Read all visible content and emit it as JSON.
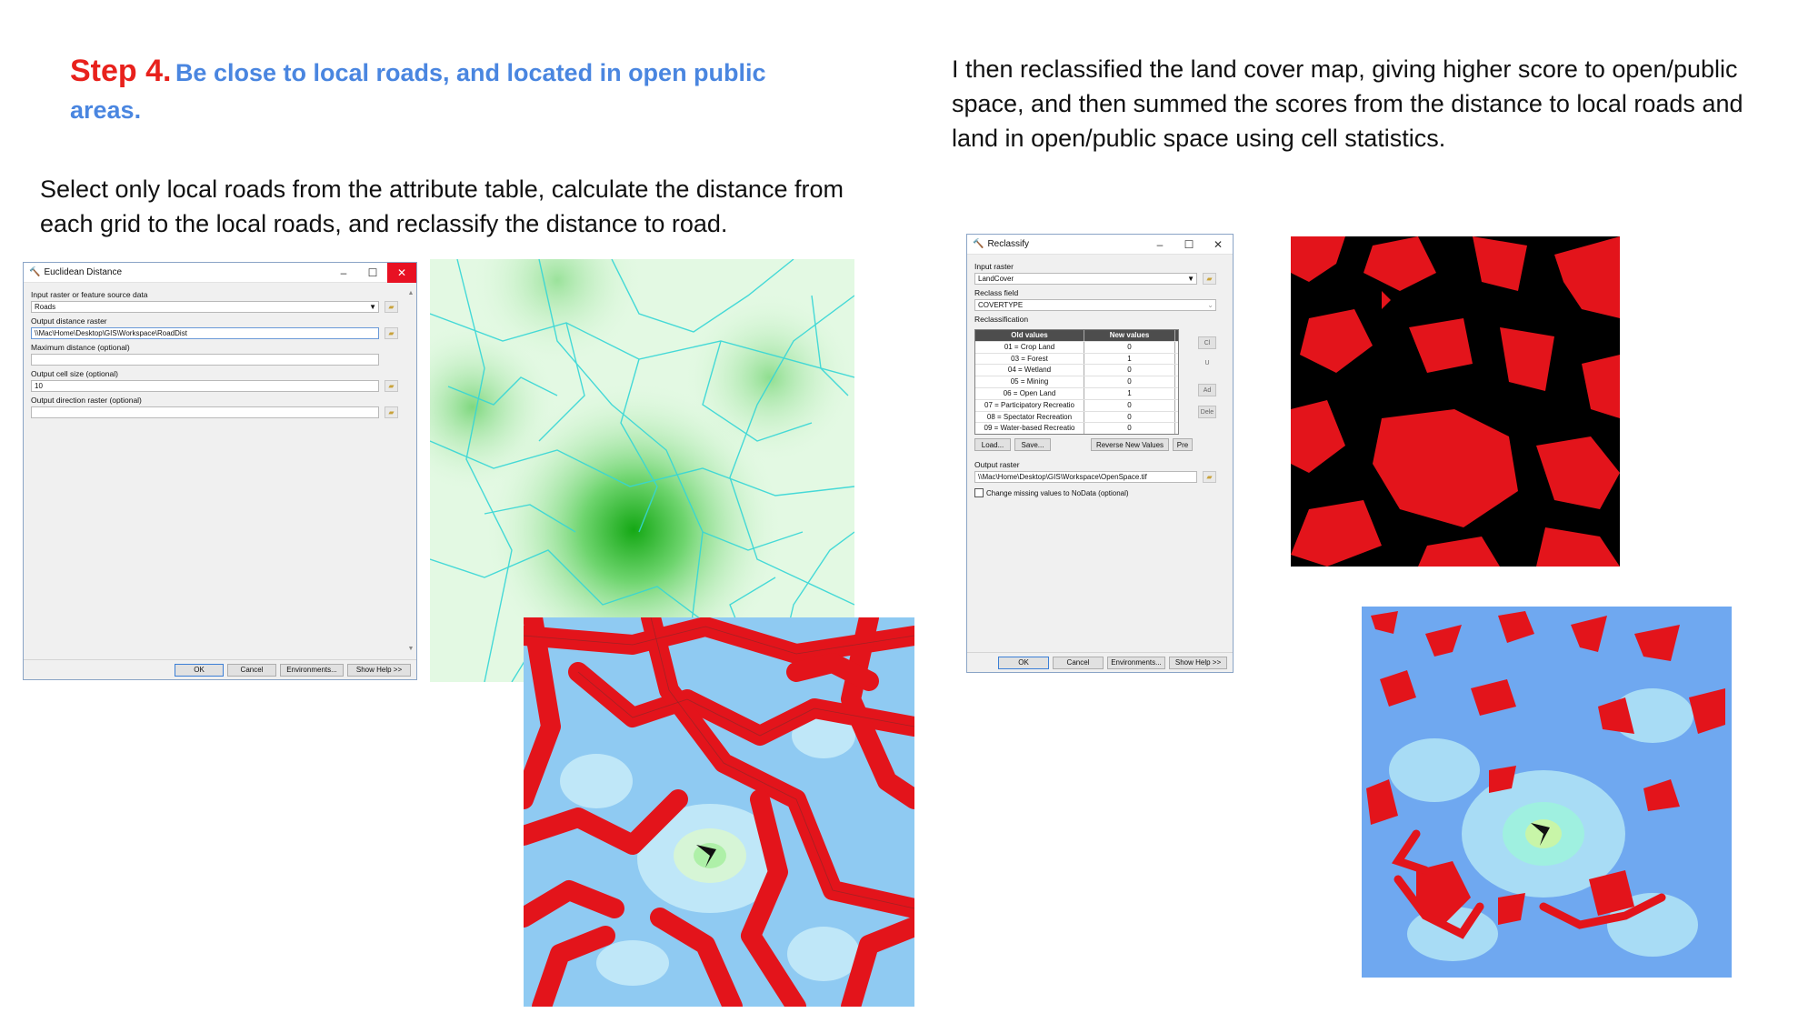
{
  "heading": {
    "step": "Step 4.",
    "title": "Be close to local roads, and located in open public areas."
  },
  "left_paragraph": "Select only local roads from the attribute table, calculate the distance from each grid to the local roads, and reclassify the distance to road.",
  "right_paragraph": "I then reclassified the land cover map, giving higher score to open/public space, and then summed the scores from the distance to local roads and land in open/public space using cell statistics.",
  "euclidean_dialog": {
    "title": "Euclidean Distance",
    "fields": [
      {
        "label": "Input raster or feature source data",
        "value": "Roads"
      },
      {
        "label": "Output distance raster",
        "value": "\\\\Mac\\Home\\Desktop\\GIS\\Workspace\\RoadDist"
      },
      {
        "label": "Maximum distance (optional)",
        "value": ""
      },
      {
        "label": "Output cell size (optional)",
        "value": "10"
      },
      {
        "label": "Output direction raster (optional)",
        "value": ""
      }
    ],
    "buttons": {
      "ok": "OK",
      "cancel": "Cancel",
      "environments": "Environments...",
      "help": "Show Help >>"
    }
  },
  "reclassify_dialog": {
    "title": "Reclassify",
    "input_raster_label": "Input raster",
    "input_raster_value": "LandCover",
    "reclass_field_label": "Reclass field",
    "reclass_field_value": "COVERTYPE",
    "reclassification_label": "Reclassification",
    "table_headers": {
      "old": "Old values",
      "new": "New values"
    },
    "rows": [
      {
        "old": "01 = Crop Land",
        "new": "0"
      },
      {
        "old": "03 = Forest",
        "new": "1"
      },
      {
        "old": "04 = Wetland",
        "new": "0"
      },
      {
        "old": "05 = Mining",
        "new": "0"
      },
      {
        "old": "06 = Open Land",
        "new": "1"
      },
      {
        "old": "07 = Participatory Recreatio",
        "new": "0"
      },
      {
        "old": "08 = Spectator Recreation",
        "new": "0"
      },
      {
        "old": "09 = Water-based Recreatio",
        "new": "0"
      }
    ],
    "side_buttons": {
      "classify": "Cl",
      "unique": "U",
      "add": "Ad",
      "delete": "Dele",
      "precision": "Pre"
    },
    "row_buttons": {
      "load": "Load...",
      "save": "Save...",
      "reverse": "Reverse New Values"
    },
    "output_raster_label": "Output raster",
    "output_raster_value": "\\\\Mac\\Home\\Desktop\\GIS\\Workspace\\OpenSpace.tif",
    "nodata_checkbox": "Change missing values to NoData (optional)",
    "buttons": {
      "ok": "OK",
      "cancel": "Cancel",
      "environments": "Environments...",
      "help": "Show Help >>"
    }
  },
  "colors": {
    "step_red": "#e8211c",
    "title_blue": "#4a86e0",
    "road_red": "#e3141b",
    "distance_green": "#1aa81a",
    "distance_light": "#e6fbe6",
    "road_cyan": "#35d6d6",
    "reclass_blue": "#6fa8f0",
    "reclass_light": "#a8dcf5"
  }
}
